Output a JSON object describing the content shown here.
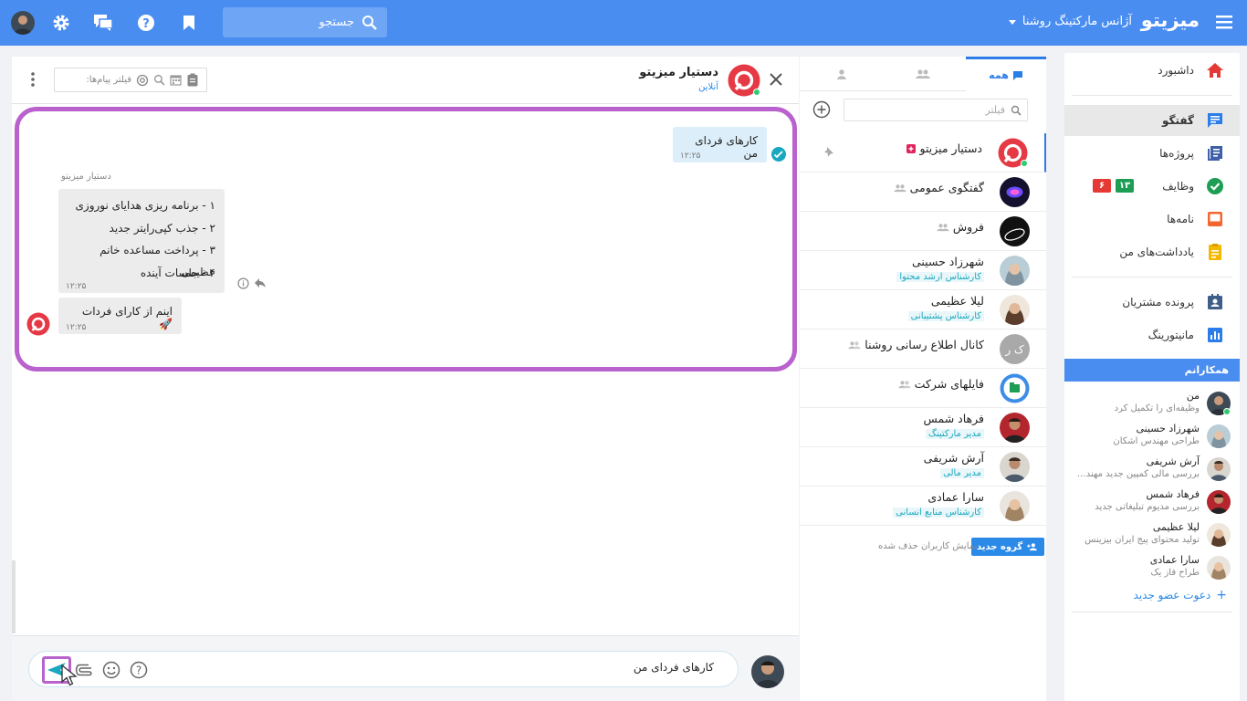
{
  "topbar": {
    "brand": "میزیتو",
    "agency": "آژانس مارکتینگ روشنا",
    "search_placeholder": "جستجو",
    "colors": {
      "bar": "#4a8df0"
    }
  },
  "nav": {
    "items": [
      {
        "label": "داشبورد",
        "icon": "home-icon"
      },
      {
        "label": "گفتگو",
        "icon": "chat-icon"
      },
      {
        "label": "پروژه‌ها",
        "icon": "projects-icon"
      },
      {
        "label": "وظایف",
        "icon": "tasks-icon",
        "badge_green": "۱۳",
        "badge_red": "۶"
      },
      {
        "label": "نامه‌ها",
        "icon": "inbox-icon"
      },
      {
        "label": "یادداشت‌های من",
        "icon": "notes-icon"
      },
      {
        "label": "پرونده مشتریان",
        "icon": "customer-file-icon"
      },
      {
        "label": "مانیتورینگ",
        "icon": "monitoring-icon"
      }
    ],
    "colleagues_title": "همکارانم",
    "colleagues": [
      {
        "name": "من",
        "sub": "وظیفه‌ای را تکمیل کرد"
      },
      {
        "name": "شهرزاد حسینی",
        "sub": "طراحی مهندس اشکان"
      },
      {
        "name": "آرش شریفی",
        "sub": "بررسی مالی کمپین جدید مهندس ز..."
      },
      {
        "name": "فرهاد شمس",
        "sub": "بررسی مدیوم تبلیغاتی جدید"
      },
      {
        "name": "لیلا عظیمی",
        "sub": "تولید محتوای پیج ایران بیزینس"
      },
      {
        "name": "سارا عمادی",
        "sub": "طراح فاز یک"
      }
    ],
    "invite": "دعوت عضو جدید"
  },
  "chatlist": {
    "tabs": [
      {
        "label": "همه"
      },
      {
        "label": ""
      },
      {
        "label": ""
      }
    ],
    "filter_placeholder": "فیلتر",
    "items": [
      {
        "name": "دستیار میزیتو",
        "role": ""
      },
      {
        "name": "گفتگوی عمومی",
        "role": ""
      },
      {
        "name": "فروش",
        "role": ""
      },
      {
        "name": "شهرزاد حسینی",
        "role": "کارشناس ارشد محتوا"
      },
      {
        "name": "لیلا عظیمی",
        "role": "کارشناس پشتیبانی"
      },
      {
        "name": "کانال اطلاع رسانی روشنا",
        "role": "",
        "initials": "ک ر"
      },
      {
        "name": "فایلهای شرکت",
        "role": ""
      },
      {
        "name": "فرهاد شمس",
        "role": "مدیر مارکتینگ"
      },
      {
        "name": "آرش شریفی",
        "role": "مدیر مالی"
      },
      {
        "name": "سارا عمادی",
        "role": "کارشناس منابع انسانی"
      }
    ],
    "new_group": "گروه جدید",
    "show_deleted": "نمایش کاربران حذف شده"
  },
  "chat": {
    "title": "دستیار میزیتو",
    "status": "آنلاین",
    "filter_placeholder": "فیلتر پیام‌ها:",
    "outgoing": {
      "text": "کارهای فردای من",
      "time": "۱۲:۲۵"
    },
    "sender": "دستیار میزیتو",
    "reply_lines": [
      "۱ - برنامه ریزی هدایای نوروزی",
      "۲ - جذب کپی‌رایتر جدید",
      "۳ - پرداخت مساعده خانم عظیمی",
      "۴ - جلسات آینده"
    ],
    "reply_time": "۱۲:۲۵",
    "reply2": {
      "text": "اینم از کارای فردات 🚀",
      "time": "۱۲:۲۵"
    },
    "composer_value": "کارهای فردای من",
    "colors": {
      "highlight": "#b961cc",
      "accent": "#2b7de9"
    }
  }
}
